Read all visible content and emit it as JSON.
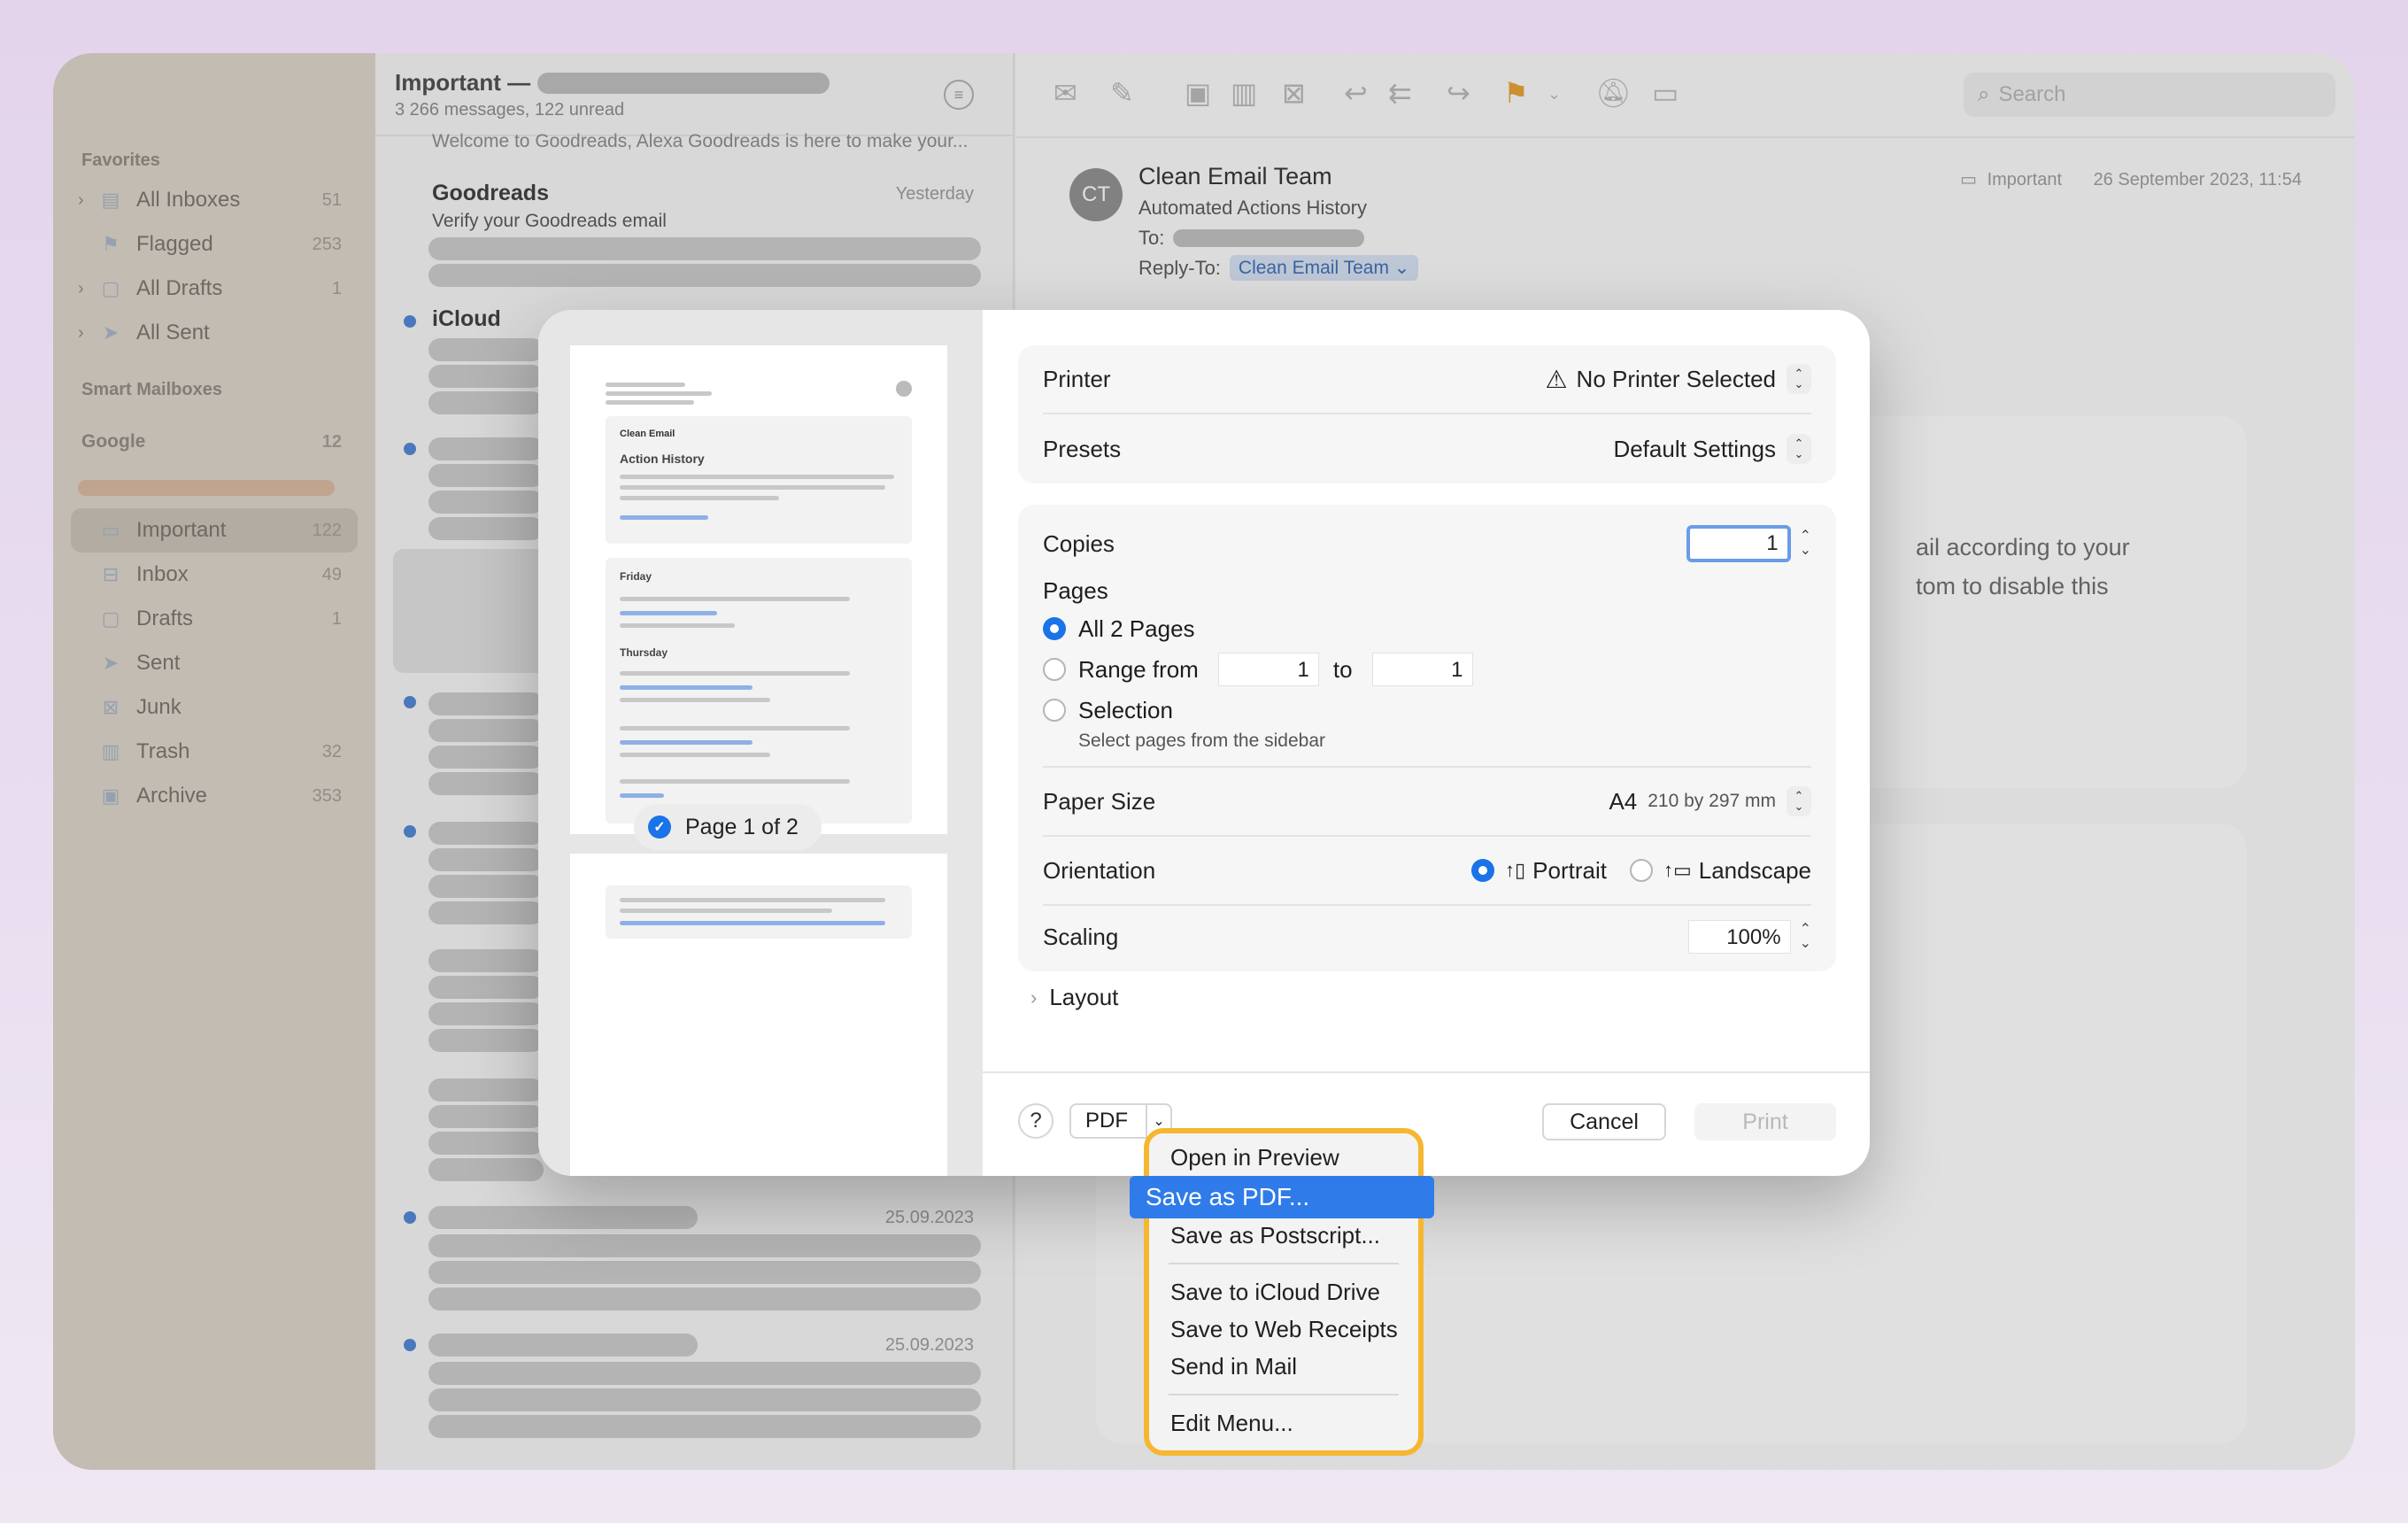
{
  "sidebar": {
    "favorites_label": "Favorites",
    "favorites": [
      {
        "label": "All Inboxes",
        "count": "51",
        "icon": "tray-stack-icon"
      },
      {
        "label": "Flagged",
        "count": "253",
        "icon": "flag-icon"
      },
      {
        "label": "All Drafts",
        "count": "1",
        "icon": "document-icon"
      },
      {
        "label": "All Sent",
        "count": "",
        "icon": "paper-plane-icon"
      }
    ],
    "smart_label": "Smart Mailboxes",
    "account": {
      "label": "Google",
      "count": "12"
    },
    "mailboxes": [
      {
        "label": "Important",
        "count": "122",
        "icon": "folder-icon"
      },
      {
        "label": "Inbox",
        "count": "49",
        "icon": "inbox-icon"
      },
      {
        "label": "Drafts",
        "count": "1",
        "icon": "document-icon"
      },
      {
        "label": "Sent",
        "count": "",
        "icon": "paper-plane-icon"
      },
      {
        "label": "Junk",
        "count": "",
        "icon": "junk-tray-icon"
      },
      {
        "label": "Trash",
        "count": "32",
        "icon": "trash-icon"
      },
      {
        "label": "Archive",
        "count": "353",
        "icon": "archive-box-icon"
      }
    ]
  },
  "list": {
    "title": "Important —",
    "subtitle": "3 266 messages, 122 unread",
    "preview_snippet": "Welcome to Goodreads, Alexa Goodreads is here to make your...",
    "goodreads": {
      "from": "Goodreads",
      "date": "Yesterday",
      "subject": "Verify your Goodreads email"
    },
    "icloud": {
      "from": "iCloud"
    },
    "date_a": "25.09.2023",
    "date_b": "25.09.2023"
  },
  "reader": {
    "search_placeholder": "Search",
    "avatar_initials": "CT",
    "sender": "Clean Email Team",
    "subject": "Automated Actions History",
    "to_label": "To:",
    "reply_to_label": "Reply-To:",
    "reply_to_value": "Clean Email Team",
    "mailbox": "Important",
    "datetime": "26 September 2023, 11:54",
    "body_line1": "ail according to your",
    "body_line2": "tom to disable this"
  },
  "dialog": {
    "preview": {
      "brand": "Clean Email",
      "heading": "Action History",
      "day1": "Friday",
      "day2": "Thursday",
      "page_badge": "Page 1 of 2"
    },
    "printer_label": "Printer",
    "printer_value": "No Printer Selected",
    "presets_label": "Presets",
    "presets_value": "Default Settings",
    "copies_label": "Copies",
    "copies_value": "1",
    "pages_label": "Pages",
    "pages_all": "All 2 Pages",
    "pages_range": "Range from",
    "range_from": "1",
    "range_to_label": "to",
    "range_to": "1",
    "pages_selection": "Selection",
    "selection_hint": "Select pages from the sidebar",
    "paper_label": "Paper Size",
    "paper_value": "A4",
    "paper_dims": "210 by 297 mm",
    "orientation_label": "Orientation",
    "portrait": "Portrait",
    "landscape": "Landscape",
    "scaling_label": "Scaling",
    "scaling_value": "100%",
    "layout_label": "Layout",
    "help": "?",
    "pdf": "PDF",
    "cancel": "Cancel",
    "print": "Print"
  },
  "pdf_menu": {
    "items": [
      "Open in Preview",
      "Save as PDF...",
      "Save as Postscript...",
      "Save to iCloud Drive",
      "Save to Web Receipts",
      "Send in Mail",
      "Edit Menu..."
    ],
    "selected_index": 1
  },
  "colors": {
    "accent": "#1a73e8",
    "menu_highlight": "#f5b731",
    "menu_selected": "#2f7bea",
    "sidebar": "#ddd5c9"
  }
}
